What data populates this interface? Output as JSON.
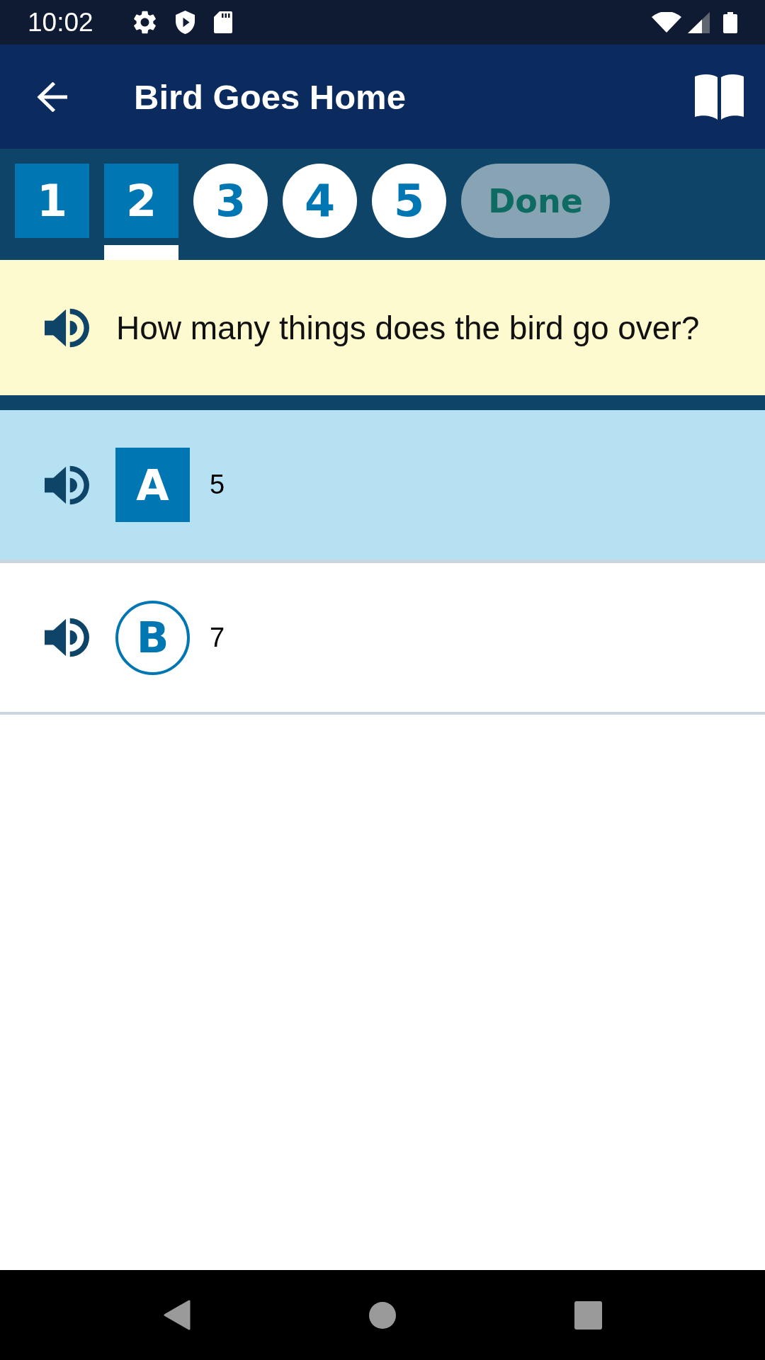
{
  "status_bar": {
    "time": "10:02"
  },
  "app_bar": {
    "title": "Bird Goes Home"
  },
  "tabs": [
    {
      "label": "1",
      "kind": "question",
      "answered": true,
      "selected": false
    },
    {
      "label": "2",
      "kind": "question",
      "answered": true,
      "selected": true
    },
    {
      "label": "3",
      "kind": "question",
      "answered": false,
      "selected": false
    },
    {
      "label": "4",
      "kind": "question",
      "answered": false,
      "selected": false
    },
    {
      "label": "5",
      "kind": "question",
      "answered": false,
      "selected": false
    },
    {
      "label": "Done",
      "kind": "done",
      "disabled": true,
      "selected": false
    }
  ],
  "question": {
    "text": "How many things does the bird go over?"
  },
  "answers": [
    {
      "label": "A",
      "text": "5",
      "selected": true
    },
    {
      "label": "B",
      "text": "7",
      "selected": false
    }
  ]
}
